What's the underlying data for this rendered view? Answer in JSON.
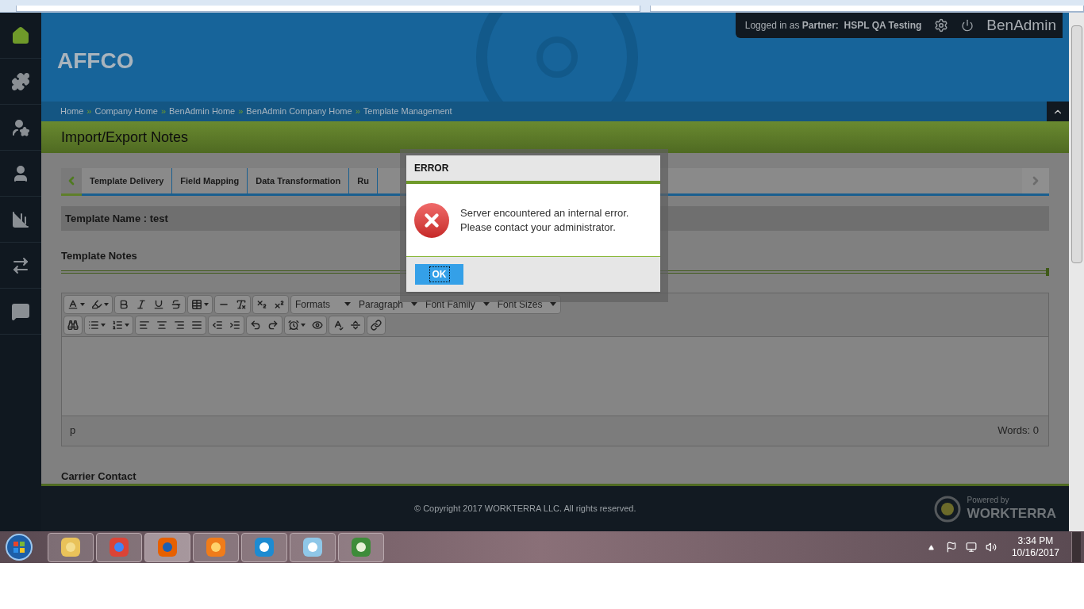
{
  "header": {
    "company": "AFFCO",
    "login_prefix": "Logged in as",
    "login_role": "Partner:",
    "login_name": "HSPL QA Testing",
    "app_name": "BenAdmin"
  },
  "sidebar": {
    "items": [
      {
        "selected": true
      },
      {
        "selected": false
      },
      {
        "selected": false
      },
      {
        "selected": false
      },
      {
        "selected": false
      },
      {
        "selected": false
      },
      {
        "selected": false
      }
    ]
  },
  "breadcrumb": [
    {
      "label": "Home"
    },
    {
      "separator": "»",
      "label": "Company Home"
    },
    {
      "separator": "»",
      "label": "BenAdmin Home"
    },
    {
      "separator": "»",
      "label": "BenAdmin Company Home"
    },
    {
      "separator": "»",
      "label": "Template Management"
    }
  ],
  "page_title": "Import/Export Notes",
  "tabs": [
    {
      "label": "Template Delivery"
    },
    {
      "label": "Field Mapping"
    },
    {
      "label": "Data Transformation"
    },
    {
      "label": "Ru"
    }
  ],
  "template_name": "Template Name : test",
  "notes_heading": "Template Notes",
  "editor": {
    "dropdowns": [
      "Formats",
      "Paragraph",
      "Font Family",
      "Font Sizes"
    ],
    "status_path": "p",
    "word_count": "Words: 0"
  },
  "carrier_heading": "Carrier Contact",
  "footer": {
    "copyright": "© Copyright 2017 WORKTERRA LLC. All rights reserved.",
    "powered_by": "Powered by",
    "brand": "WORKTERRA"
  },
  "dialog": {
    "title": "ERROR",
    "message_lines": [
      "Server encountered an internal error.",
      "Please contact your administrator."
    ],
    "button": "OK"
  },
  "taskbar": {
    "time": "3:34 PM",
    "date": "10/16/2017"
  }
}
